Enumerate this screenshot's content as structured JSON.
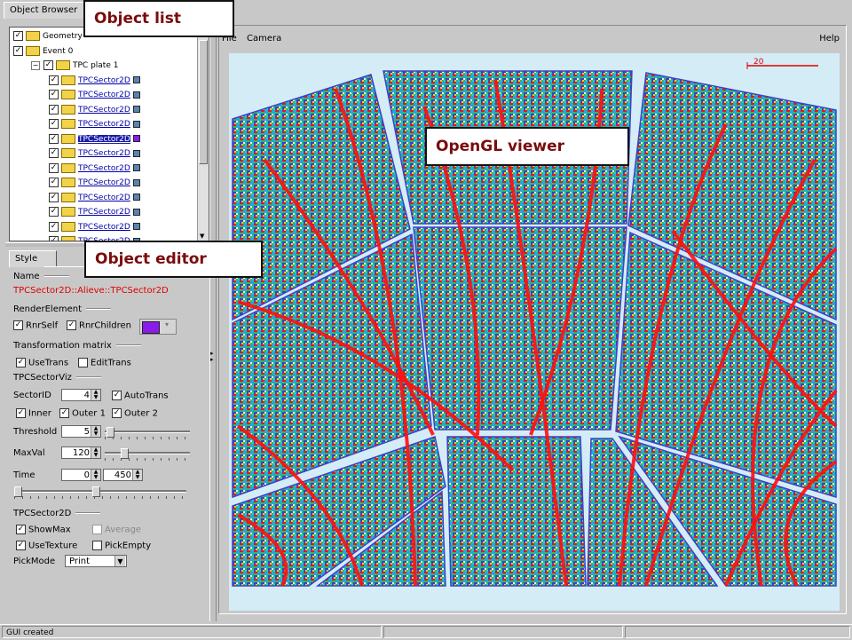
{
  "browser": {
    "tab_label": "Object Browser",
    "tree": [
      {
        "label": "Geometry",
        "indent": 0,
        "checked": true
      },
      {
        "label": "Event 0",
        "indent": 0,
        "checked": true
      },
      {
        "label": "TPC plate 1",
        "indent": 1,
        "checked": true,
        "expander": "−"
      },
      {
        "label": "TPCSector2D",
        "indent": 2,
        "checked": true,
        "link": true
      },
      {
        "label": "TPCSector2D",
        "indent": 2,
        "checked": true,
        "link": true
      },
      {
        "label": "TPCSector2D",
        "indent": 2,
        "checked": true,
        "link": true
      },
      {
        "label": "TPCSector2D",
        "indent": 2,
        "checked": true,
        "link": true
      },
      {
        "label": "TPCSector2D",
        "indent": 2,
        "checked": true,
        "link": true,
        "selected": true
      },
      {
        "label": "TPCSector2D",
        "indent": 2,
        "checked": true,
        "link": true
      },
      {
        "label": "TPCSector2D",
        "indent": 2,
        "checked": true,
        "link": true
      },
      {
        "label": "TPCSector2D",
        "indent": 2,
        "checked": true,
        "link": true
      },
      {
        "label": "TPCSector2D",
        "indent": 2,
        "checked": true,
        "link": true
      },
      {
        "label": "TPCSector2D",
        "indent": 2,
        "checked": true,
        "link": true
      },
      {
        "label": "TPCSector2D",
        "indent": 2,
        "checked": true,
        "link": true
      },
      {
        "label": "TPCSector2D",
        "indent": 2,
        "checked": true,
        "link": true
      }
    ]
  },
  "editor": {
    "tab_label": "Style",
    "name_section": "Name",
    "name_value": "TPCSector2D::Alieve::TPCSector2D",
    "render_section": "RenderElement",
    "rnr_self": "RnrSelf",
    "rnr_children": "RnrChildren",
    "render_color": "#8a1be8",
    "transform_section": "Transformation matrix",
    "use_trans": "UseTrans",
    "edit_trans": "EditTrans",
    "viz_section": "TPCSectorViz",
    "sector_id_label": "SectorID",
    "sector_id_value": "4",
    "auto_trans": "AutoTrans",
    "inner": "Inner",
    "outer1": "Outer 1",
    "outer2": "Outer 2",
    "threshold_label": "Threshold",
    "threshold_value": "5",
    "threshold_slider": 0.02,
    "maxval_label": "MaxVal",
    "maxval_value": "120",
    "maxval_slider": 0.2,
    "time_label": "Time",
    "time_min": "0",
    "time_max": "450",
    "s2d_section": "TPCSector2D",
    "show_max": "ShowMax",
    "average": "Average",
    "use_texture": "UseTexture",
    "pick_empty": "PickEmpty",
    "pick_mode_label": "PickMode",
    "pick_mode_value": "Print"
  },
  "viewer": {
    "menu": [
      "File",
      "Camera"
    ],
    "help": "Help",
    "scale_value": "20"
  },
  "callouts": {
    "object_list": "Object list",
    "object_editor": "Object editor",
    "opengl_viewer": "OpenGL viewer"
  },
  "status": {
    "text": "GUI created"
  },
  "colors": {
    "viewer_bg": "#d4ecf6",
    "sector_outline": "#4040c8",
    "track": "#ff1010",
    "selected": "#1b1baa"
  }
}
